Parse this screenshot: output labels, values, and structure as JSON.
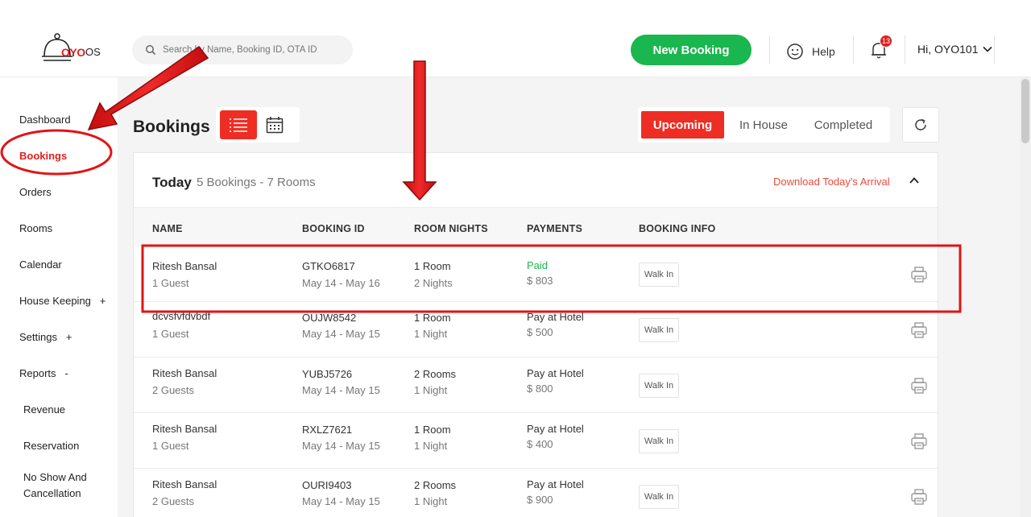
{
  "header": {
    "brand": "OYO",
    "brand_suffix": "OS",
    "search_placeholder": "Search by Name, Booking ID, OTA ID",
    "new_booking_label": "New Booking",
    "help_label": "Help",
    "notification_count": "13",
    "user_greeting": "Hi, OYO101"
  },
  "sidebar": {
    "items": [
      {
        "label": "Dashboard"
      },
      {
        "label": "Bookings",
        "active": true
      },
      {
        "label": "Orders"
      },
      {
        "label": "Rooms"
      },
      {
        "label": "Calendar"
      },
      {
        "label": "House Keeping",
        "toggle": "+"
      },
      {
        "label": "Settings",
        "toggle": "+"
      },
      {
        "label": "Reports",
        "toggle": "-"
      }
    ],
    "sub_items": [
      {
        "label": "Revenue"
      },
      {
        "label": "Reservation"
      },
      {
        "label": "No Show And"
      },
      {
        "label": "Cancellation"
      }
    ]
  },
  "main": {
    "title": "Bookings",
    "filters": [
      "Upcoming",
      "In House",
      "Completed"
    ],
    "active_filter": "Upcoming",
    "card": {
      "title": "Today",
      "summary": "5 Bookings - 7 Rooms",
      "download_label": "Download Today's Arrival"
    },
    "columns": [
      "NAME",
      "BOOKING ID",
      "ROOM NIGHTS",
      "PAYMENTS",
      "BOOKING INFO"
    ],
    "rows": [
      {
        "name": "Ritesh Bansal",
        "guests": "1 Guest",
        "booking_id": "GTKO6817",
        "dates": "May 14 - May 16",
        "rooms": "1 Room",
        "nights": "2 Nights",
        "payment_status": "Paid",
        "amount": "$ 803",
        "info": "Walk In"
      },
      {
        "name": "dcvsfvfdvbdf",
        "guests": "1 Guest",
        "booking_id": "OUJW8542",
        "dates": "May 14 - May 15",
        "rooms": "1 Room",
        "nights": "1 Night",
        "payment_status": "Pay at Hotel",
        "amount": "$ 500",
        "info": "Walk In"
      },
      {
        "name": "Ritesh Bansal",
        "guests": "2 Guests",
        "booking_id": "YUBJ5726",
        "dates": "May 14 - May 15",
        "rooms": "2 Rooms",
        "nights": "1 Night",
        "payment_status": "Pay at Hotel",
        "amount": "$ 800",
        "info": "Walk In"
      },
      {
        "name": "Ritesh Bansal",
        "guests": "1 Guest",
        "booking_id": "RXLZ7621",
        "dates": "May 14 - May 15",
        "rooms": "1 Room",
        "nights": "1 Night",
        "payment_status": "Pay at Hotel",
        "amount": "$ 400",
        "info": "Walk In"
      },
      {
        "name": "Ritesh Bansal",
        "guests": "2 Guests",
        "booking_id": "OURI9403",
        "dates": "May 14 - May 15",
        "rooms": "2 Rooms",
        "nights": "1 Night",
        "payment_status": "Pay at Hotel",
        "amount": "$ 900",
        "info": "Walk In"
      }
    ]
  },
  "colors": {
    "brand_red": "#ee2e24",
    "brand_green": "#1ab64f",
    "annotation_red": "#e11414"
  }
}
